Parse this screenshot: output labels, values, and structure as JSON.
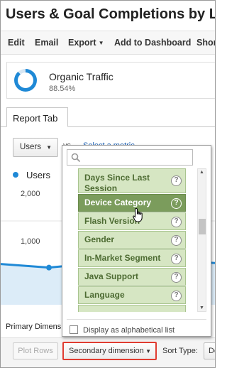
{
  "report": {
    "title": "Users & Goal Completions by La"
  },
  "toolbar": {
    "edit": "Edit",
    "email": "Email",
    "export": "Export",
    "add_to_dashboard": "Add to Dashboard",
    "shortcut": "Shor"
  },
  "segment": {
    "name": "Organic Traffic",
    "percent": "88.54%",
    "share": 0.8854
  },
  "tab": {
    "label": "Report Tab"
  },
  "metric": {
    "selected": "Users",
    "vs": "vs",
    "select_metric": "Select a metric"
  },
  "chart_data": {
    "type": "line",
    "series": [
      {
        "name": "Users",
        "values": [
          1100,
          1020,
          1120,
          1180,
          1090
        ]
      }
    ],
    "yticks": [
      "2,000",
      "1,000"
    ],
    "ylim": [
      0,
      2500
    ]
  },
  "dropdown": {
    "search_placeholder": "",
    "items": [
      {
        "label": "Days Since Last Session",
        "line1": "Days Since Last",
        "line2": "Session",
        "selected": false
      },
      {
        "label": "Device Category",
        "selected": true
      },
      {
        "label": "Flash Version",
        "selected": false
      },
      {
        "label": "Gender",
        "selected": false
      },
      {
        "label": "In-Market Segment",
        "selected": false
      },
      {
        "label": "Java Support",
        "selected": false
      },
      {
        "label": "Language",
        "selected": false
      }
    ],
    "help_glyph": "?",
    "alphabetical_label": "Display as alphabetical list"
  },
  "bottom": {
    "primary_dimension": "Primary Dimensio",
    "plot_rows": "Plot Rows",
    "secondary_dimension": "Secondary dimension",
    "sort_type": "Sort Type:",
    "sort_value": "De"
  },
  "colors": {
    "accent": "#1f89d6",
    "item_bg": "#d6e6c3",
    "item_selected": "#7b9c5c",
    "highlight": "#e03c31"
  }
}
